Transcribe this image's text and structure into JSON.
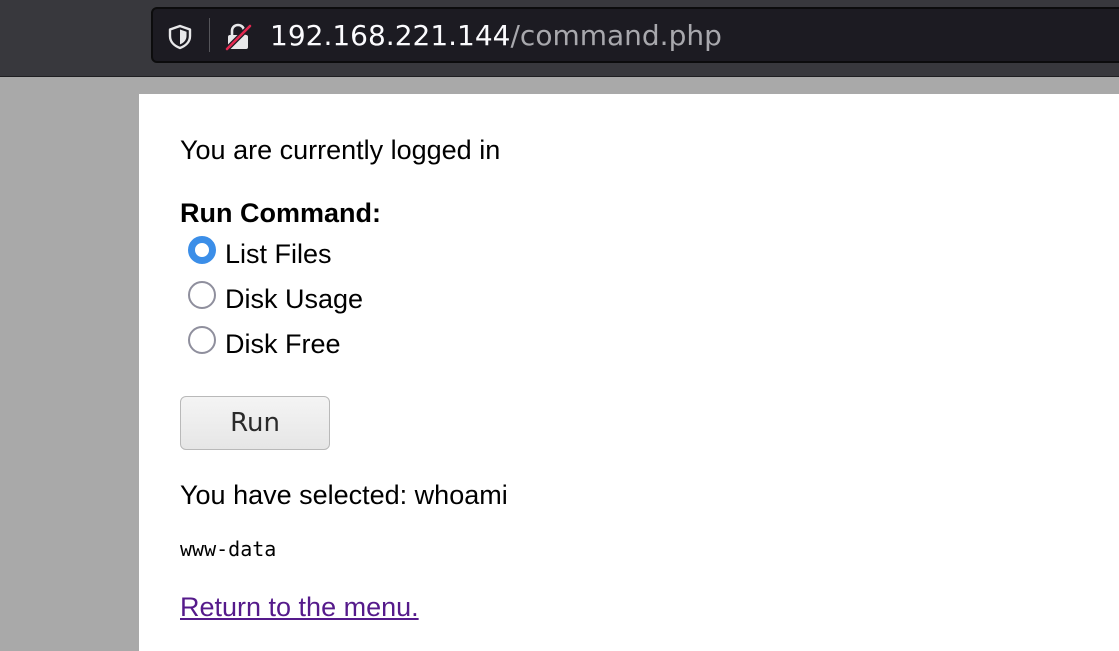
{
  "browser": {
    "url_host": "192.168.221.144",
    "url_path": "/command.php",
    "icons": [
      "shield-icon",
      "insecure-lock-icon"
    ]
  },
  "page": {
    "status_text": "You are currently logged in",
    "form_title": "Run Command:",
    "options": [
      {
        "label": "List Files",
        "checked": true
      },
      {
        "label": "Disk Usage",
        "checked": false
      },
      {
        "label": "Disk Free",
        "checked": false
      }
    ],
    "run_button_label": "Run",
    "selected_text": "You have selected: whoami",
    "output_text": "www-data",
    "return_link_text": "Return to the menu."
  },
  "colors": {
    "radio_checked": "#3b8ee8",
    "visited_link": "#551a8b",
    "lock_slash": "#e22850"
  }
}
